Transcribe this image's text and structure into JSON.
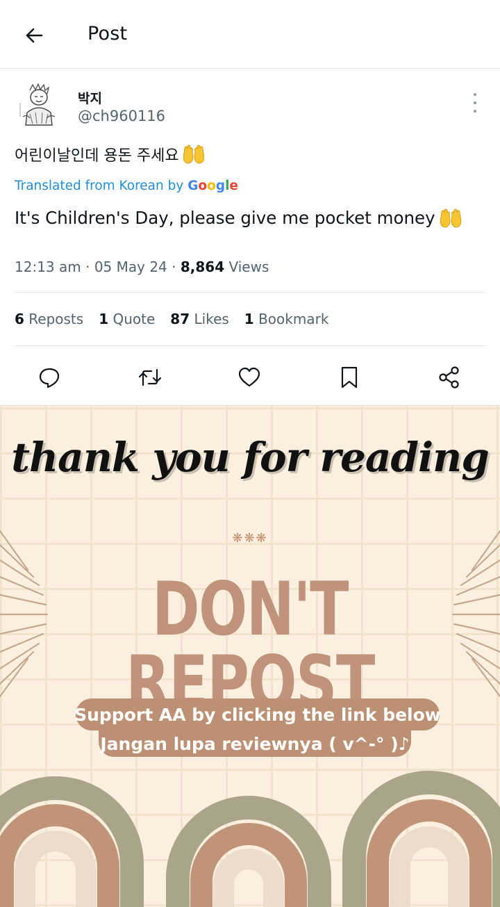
{
  "header": {
    "title": "Post"
  },
  "post": {
    "author_name": "박지",
    "author_handle": "@ch960116",
    "original_text": "어린이날인데 용돈 주세요",
    "translated_label": "Translated from Korean by",
    "translated_brand": "Google",
    "translation": "It's Children's Day, please give me pocket money",
    "time": "12:13 am",
    "date": "05 May 24",
    "views_count": "8,864",
    "views_label": "Views"
  },
  "stats": [
    {
      "count": "6",
      "label": "Reposts"
    },
    {
      "count": "1",
      "label": "Quote"
    },
    {
      "count": "87",
      "label": "Likes"
    },
    {
      "count": "1",
      "label": "Bookmark"
    }
  ],
  "actions": [
    "reply-icon",
    "repost-icon",
    "like-icon",
    "bookmark-icon",
    "share-icon"
  ],
  "banner": {
    "heading": "thank you for reading",
    "ornament": "❋❋❋",
    "warning": "DON'T REPOST",
    "line1": "Support AA by clicking the link below",
    "line2": "Jangan lupa reviewnya ( v^-° )♪",
    "colors": {
      "background": "#fbf0df",
      "accent": "#bd8f73",
      "sage": "#aaa48a",
      "blush": "#ecdccb"
    }
  }
}
